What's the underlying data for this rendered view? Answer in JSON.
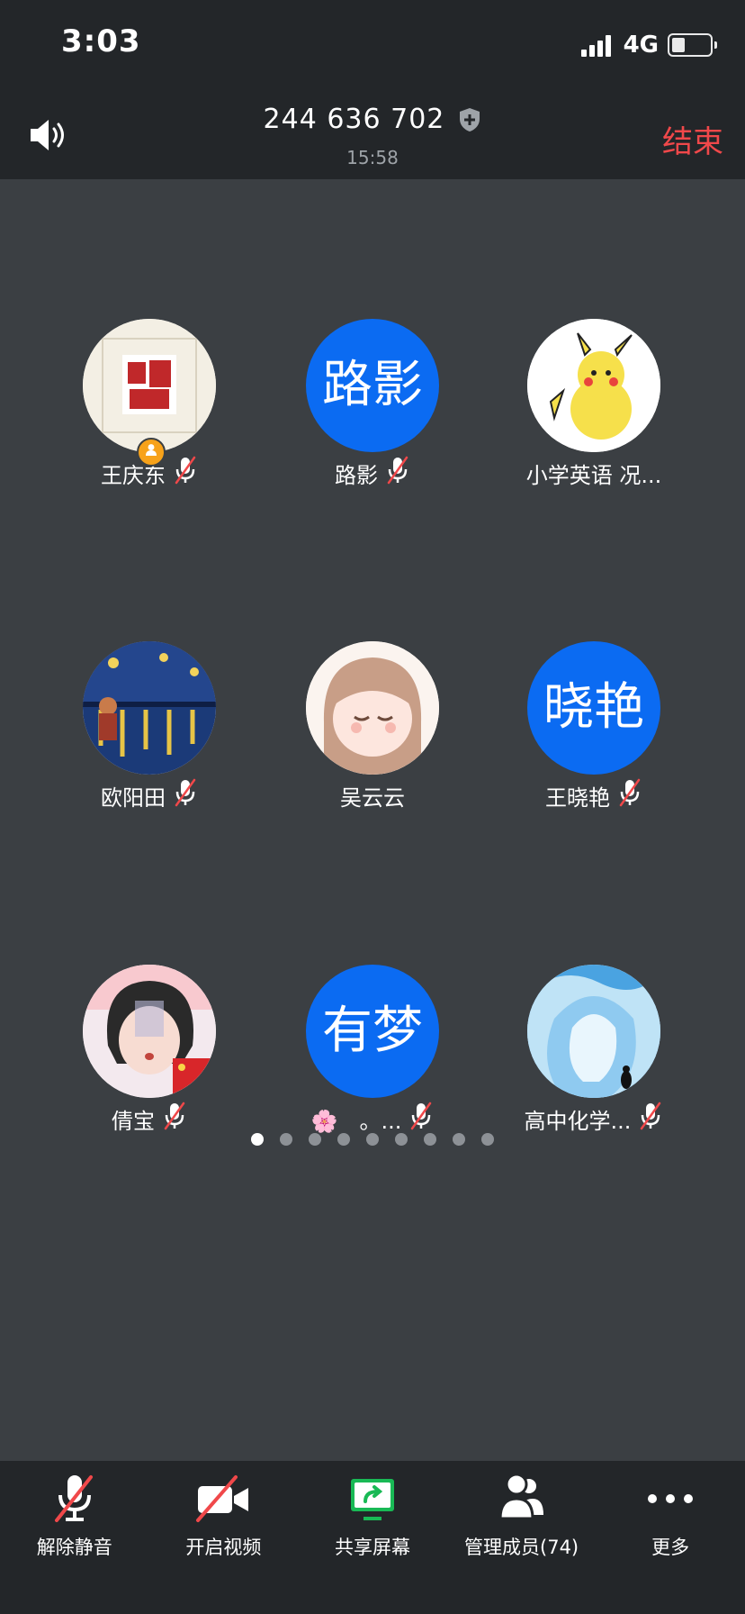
{
  "status": {
    "time": "3:03",
    "network": "4G",
    "battery_level": 0.35
  },
  "header": {
    "meeting_id": "244 636 702",
    "duration": "15:58",
    "end_label": "结束"
  },
  "participants": [
    {
      "name": "王庆东",
      "avatar_type": "image",
      "muted": true,
      "host": true
    },
    {
      "name": "路影",
      "avatar_type": "text",
      "avatar_text": "路影",
      "muted": true
    },
    {
      "name": "小学英语 况...",
      "avatar_type": "image",
      "muted": false
    },
    {
      "name": "欧阳田",
      "avatar_type": "image",
      "muted": true
    },
    {
      "name": "吴云云",
      "avatar_type": "image",
      "muted": false
    },
    {
      "name": "王晓艳",
      "avatar_type": "text",
      "avatar_text": "晓艳",
      "muted": true
    },
    {
      "name": "倩宝",
      "avatar_type": "image",
      "muted": true
    },
    {
      "name": "🌸　。...",
      "avatar_type": "text",
      "avatar_text": "有梦",
      "muted": true
    },
    {
      "name": "高中化学...",
      "avatar_type": "image",
      "muted": true
    }
  ],
  "pagination": {
    "pages": 9,
    "current": 1
  },
  "toolbar": {
    "unmute_label": "解除静音",
    "video_label": "开启视频",
    "share_label": "共享屏幕",
    "members_label": "管理成员(74)",
    "more_label": "更多"
  },
  "colors": {
    "accent_blue": "#0b6bf2",
    "end_red": "#f0484a",
    "share_green": "#19b955",
    "host_badge": "#f7a21a"
  }
}
